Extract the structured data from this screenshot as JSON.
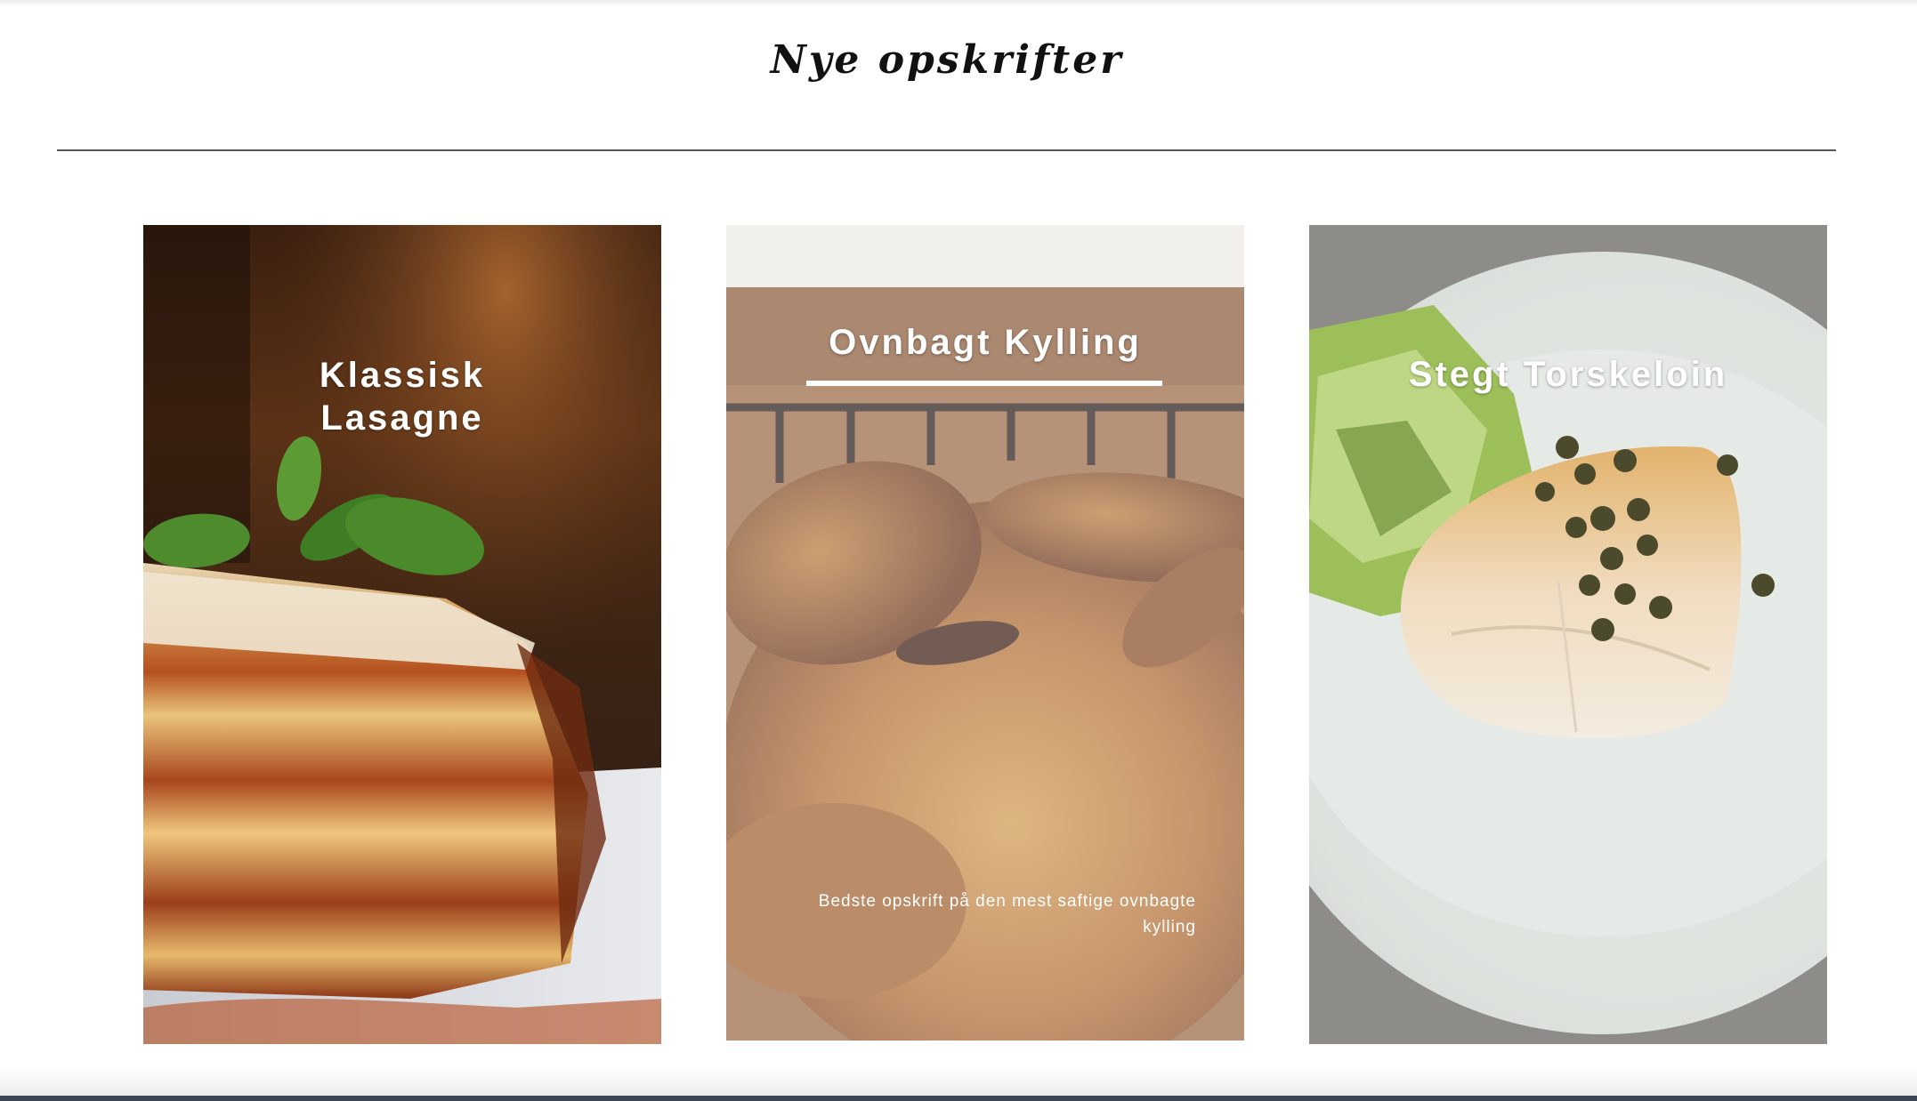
{
  "page": {
    "title": "Nye opskrifter"
  },
  "recipes": [
    {
      "title": "Klassisk Lasagne",
      "image": "lasagne-photo"
    },
    {
      "title": "Ovnbagt Kylling",
      "description": "Bedste opskrift på den mest saftige ovnbagte kylling",
      "image": "roast-chicken-photo"
    },
    {
      "title": "Stegt Torskeloin",
      "image": "fried-cod-photo"
    }
  ],
  "colors": {
    "text": "#111111",
    "overlay_text": "#ffffff",
    "divider": "#555555",
    "bottom_bar": "#3c4654"
  }
}
